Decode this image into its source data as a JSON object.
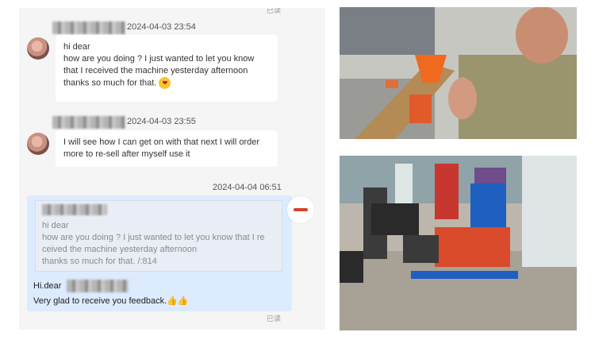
{
  "chat": {
    "read_top": "已读",
    "read_bottom": "已读",
    "msg1": {
      "timestamp": "2024-04-03 23:54",
      "lines": [
        "hi dear",
        "how are you doing ? I just wanted to let you know",
        "that I received the machine yesterday afternoon",
        "thanks so much for that."
      ]
    },
    "msg2": {
      "timestamp": "2024-04-03 23:55",
      "lines": [
        "I will see how I can get on with that next I will order",
        "more to re-sell after myself use it"
      ]
    },
    "reply": {
      "timestamp": "2024-04-04 06:51",
      "quote_lines": [
        "hi dear",
        "how are you doing ? I just wanted to let you know that I re",
        "ceived the machine yesterday afternoon",
        "thanks so much for that. /:814"
      ],
      "greeting": "Hi.dear",
      "body": "Very glad to receive you feedback."
    }
  },
  "icons": {
    "emoji": "kiss-emoji-icon",
    "thumbs": "thumbs-up-icon"
  },
  "colors": {
    "reply_bubble": "#ddebff",
    "accent": "#d4432c"
  }
}
